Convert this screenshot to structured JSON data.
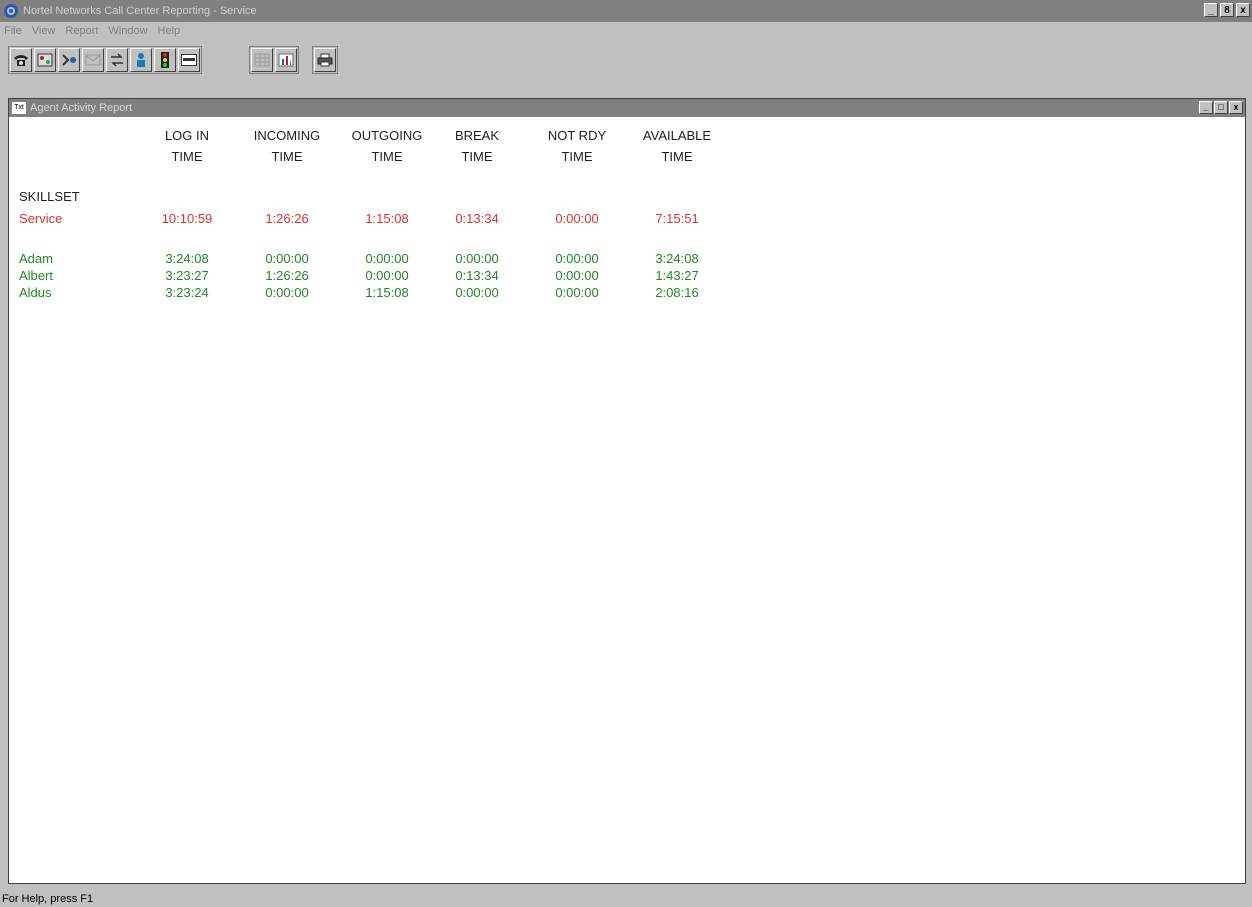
{
  "app": {
    "title": "Nortel Networks Call Center Reporting - Service",
    "window_buttons": [
      "_",
      "8",
      "x"
    ]
  },
  "menu": [
    "File",
    "View",
    "Report",
    "Window",
    "Help"
  ],
  "toolbar": {
    "icons": [
      "telephone-icon",
      "agent-map-icon",
      "skillset-icon",
      "mail-icon",
      "transfer-icon",
      "person-icon",
      "traffic-light-icon",
      "id-card-icon",
      "grid-icon",
      "chart-icon",
      "print-icon"
    ]
  },
  "child_window": {
    "title": "Agent Activity Report",
    "icon_text": "Txt",
    "buttons": [
      "_",
      "□",
      "x"
    ]
  },
  "report": {
    "columns": [
      {
        "line1": "LOG IN",
        "line2": "TIME"
      },
      {
        "line1": "INCOMING",
        "line2": "TIME"
      },
      {
        "line1": "OUTGOING",
        "line2": "TIME"
      },
      {
        "line1": "BREAK",
        "line2": "TIME"
      },
      {
        "line1": "NOT RDY",
        "line2": "TIME"
      },
      {
        "line1": "AVAILABLE",
        "line2": "TIME"
      }
    ],
    "section_label": "SKILLSET",
    "skillset": {
      "name": "Service",
      "values": [
        "10:10:59",
        "1:26:26",
        "1:15:08",
        "0:13:34",
        "0:00:00",
        "7:15:51"
      ]
    },
    "agents": [
      {
        "name": "Adam",
        "values": [
          "3:24:08",
          "0:00:00",
          "0:00:00",
          "0:00:00",
          "0:00:00",
          "3:24:08"
        ]
      },
      {
        "name": "Albert",
        "values": [
          "3:23:27",
          "1:26:26",
          "0:00:00",
          "0:13:34",
          "0:00:00",
          "1:43:27"
        ]
      },
      {
        "name": "Aldus",
        "values": [
          "3:23:24",
          "0:00:00",
          "1:15:08",
          "0:00:00",
          "0:00:00",
          "2:08:16"
        ]
      }
    ]
  },
  "status": "For Help, press F1"
}
